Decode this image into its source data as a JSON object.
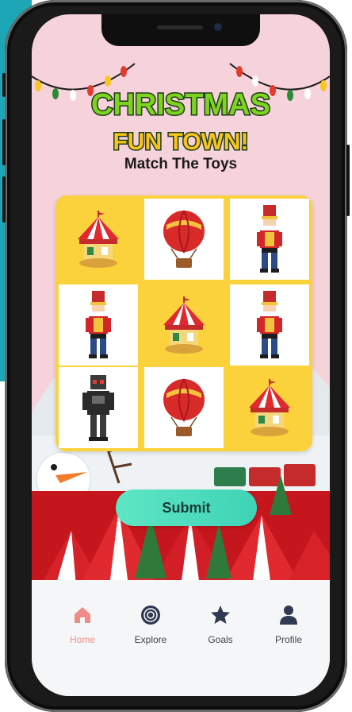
{
  "app": {
    "logo_line1": "CHRISTMAS",
    "logo_line2": "FUN TOWN!",
    "subtitle": "Match The Toys"
  },
  "board": {
    "cells": [
      {
        "toy": "carousel",
        "bg": "yellow"
      },
      {
        "toy": "hot-air-balloon",
        "bg": "white"
      },
      {
        "toy": "nutcracker",
        "bg": "white"
      },
      {
        "toy": "nutcracker",
        "bg": "white"
      },
      {
        "toy": "carousel",
        "bg": "yellow"
      },
      {
        "toy": "nutcracker",
        "bg": "white"
      },
      {
        "toy": "robot",
        "bg": "white"
      },
      {
        "toy": "hot-air-balloon",
        "bg": "white"
      },
      {
        "toy": "carousel",
        "bg": "yellow"
      }
    ]
  },
  "submit": {
    "label": "Submit"
  },
  "tabs": [
    {
      "label": "Home",
      "icon": "home-icon",
      "active": true
    },
    {
      "label": "Explore",
      "icon": "explore-icon",
      "active": false
    },
    {
      "label": "Goals",
      "icon": "star-icon",
      "active": false
    },
    {
      "label": "Profile",
      "icon": "profile-icon",
      "active": false
    }
  ],
  "colors": {
    "accent": "#fbd23c",
    "active_tab": "#f08c88",
    "submit": "#4fdcbd",
    "background": "#f6d2da"
  }
}
